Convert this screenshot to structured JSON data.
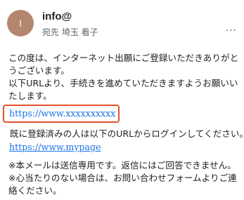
{
  "header": {
    "avatar_letter": "I",
    "sender": "info@",
    "recipient": "宛先 埼玉 看子",
    "more_label": "···"
  },
  "body": {
    "paragraph1": "この度は、インターネット出願にご登録いただきありがとうございます。",
    "paragraph2": "以下URLより、手続きを進めていただきますようお願いいたします。",
    "link1": "https://www.xxxxxxxxxx",
    "registered_line": "既に登録済みの人は以下のURLからログインしてください。",
    "link2": "https://www.mypage",
    "note1": "※本メールは送信専用です。返信にはご回答できません。",
    "note2": "※心当たりのない場合は、お問い合わせフォームよりご連絡ください。"
  },
  "colors": {
    "avatar_bg": "#b5866f",
    "link": "#1a73e8",
    "highlight_border": "#e2532c"
  }
}
